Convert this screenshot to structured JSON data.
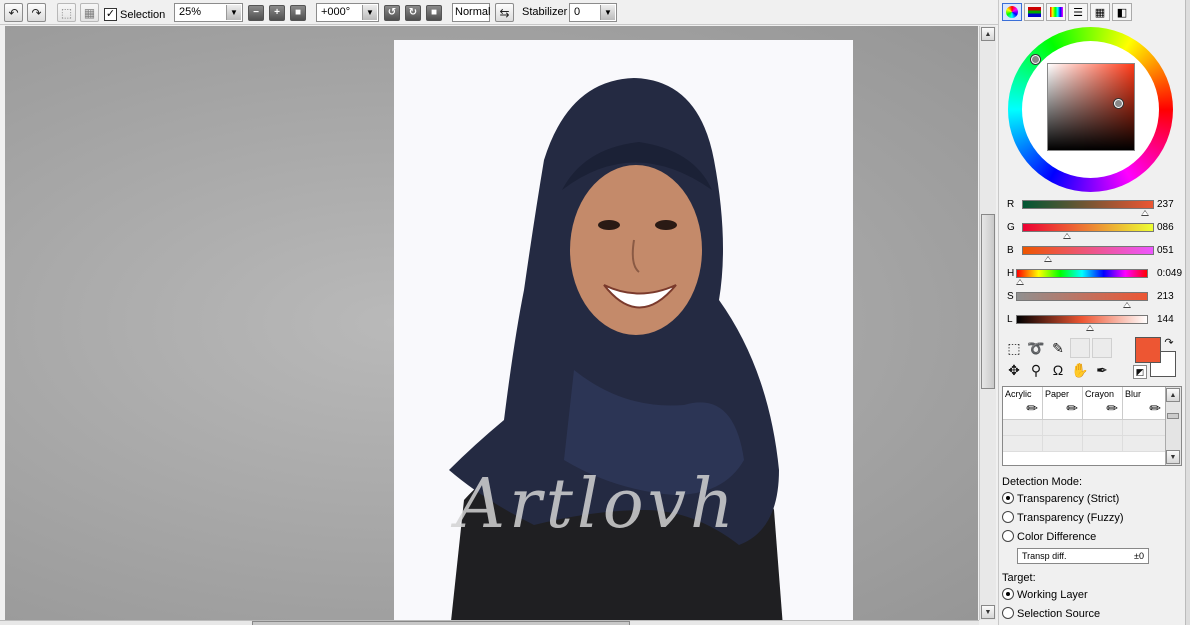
{
  "toolbar": {
    "selection_label": "Selection",
    "selection_checked": "✓",
    "zoom_value": "25%",
    "angle_value": "+000°",
    "blend_mode": "Normal",
    "stabilizer_label": "Stabilizer",
    "stabilizer_value": "0"
  },
  "canvas": {
    "watermark_text": "Artlovh"
  },
  "color": {
    "accent": "#ed5633",
    "sliders": [
      {
        "label": "R",
        "value": "237"
      },
      {
        "label": "G",
        "value": "086"
      },
      {
        "label": "B",
        "value": "051"
      },
      {
        "label": "H",
        "value": "0:049"
      },
      {
        "label": "S",
        "value": "213"
      },
      {
        "label": "L",
        "value": "144"
      }
    ],
    "slider_levels": [
      0.93,
      0.34,
      0.2,
      0.03,
      0.84,
      0.56
    ]
  },
  "tools": [
    "selection-rect-icon",
    "lasso-icon",
    "magic-wand-icon",
    "move-icon",
    "zoom-icon",
    "rotate-icon",
    "hand-icon",
    "eyedropper-icon"
  ],
  "brushes": [
    {
      "name": "Acrylic"
    },
    {
      "name": "Paper"
    },
    {
      "name": "Crayon"
    },
    {
      "name": "Blur"
    }
  ],
  "detection": {
    "title": "Detection Mode:",
    "options": [
      "Transparency (Strict)",
      "Transparency (Fuzzy)",
      "Color Difference"
    ],
    "selected": 0,
    "field_label": "Transp diff.",
    "field_value": "±0"
  },
  "target": {
    "title": "Target:",
    "options": [
      "Working Layer",
      "Selection Source"
    ],
    "selected": 0
  }
}
